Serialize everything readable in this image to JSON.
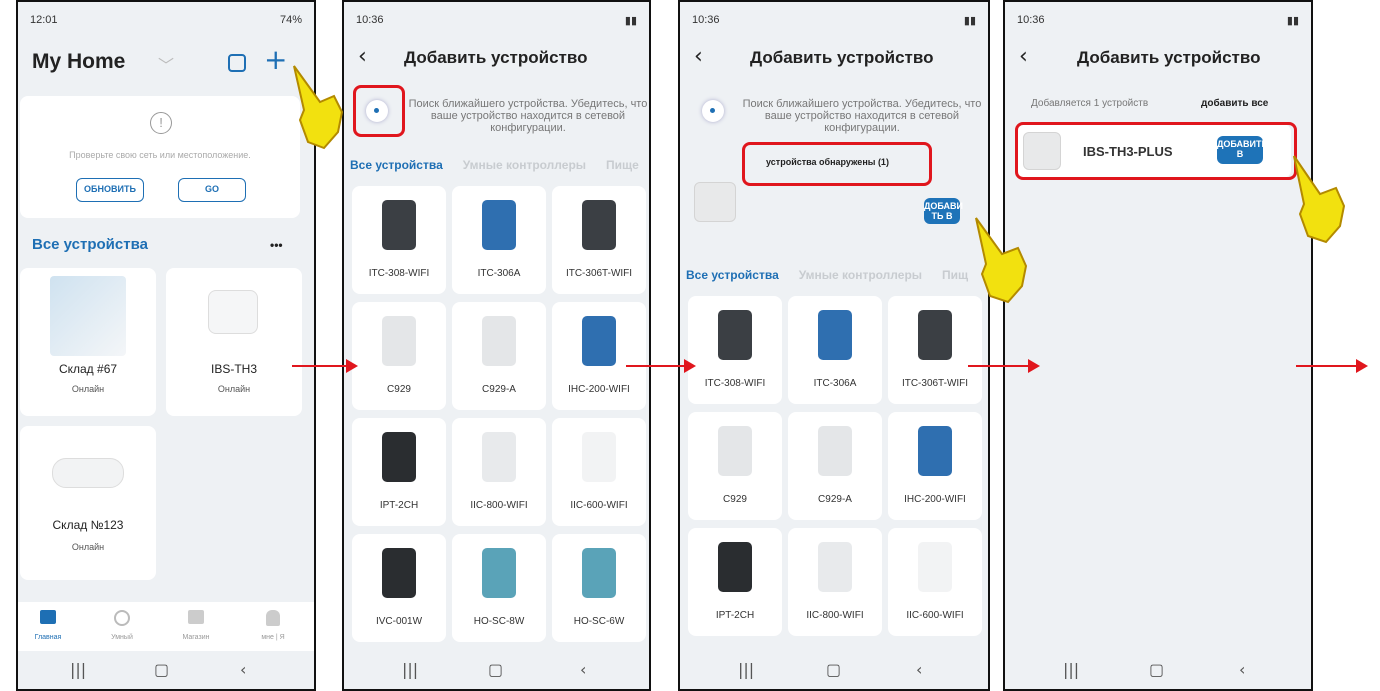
{
  "p1": {
    "status_time": "12:01",
    "status_right": "74%",
    "title": "My Home",
    "alert_text": "Проверьте свою сеть или местоположение.",
    "btn_refresh": "ОБНОВИТЬ",
    "btn_go": "GO",
    "section": "Все устройства",
    "more": "•••",
    "devices": [
      {
        "name": "Склад #67",
        "status": "Онлайн"
      },
      {
        "name": "IBS-TH3",
        "status": "Онлайн"
      },
      {
        "name": "Склад №123",
        "status": "Онлайн"
      }
    ],
    "nav": [
      "Главная",
      "Умный",
      "Магазин",
      "мне | Я"
    ]
  },
  "p2": {
    "status_time": "10:36",
    "title": "Добавить устройство",
    "search_text": "Поиск ближайшего устройства. Убедитесь, что ваше устройство находится в сетевой конфигурации.",
    "tabs": [
      "Все устройства",
      "Умные контроллеры",
      "Пище"
    ],
    "tiles": [
      "ITC-308-WIFI",
      "ITC-306A",
      "ITC-306T-WIFI",
      "C929",
      "C929-A",
      "IHC-200-WIFI",
      "IPT-2CH",
      "IIC-800-WIFI",
      "IIC-600-WIFI",
      "IVC-001W",
      "HO-SC-8W",
      "HO-SC-6W"
    ]
  },
  "p3": {
    "status_time": "10:36",
    "title": "Добавить устройство",
    "search_text": "Поиск ближайшего устройства. Убедитесь, что ваше устройство находится в сетевой конфигурации.",
    "found": "устройства обнаружены (1)",
    "add_btn": "ДОБАВИ ТЬ В",
    "tabs": [
      "Все устройства",
      "Умные контроллеры",
      "Пищ"
    ],
    "tiles": [
      "ITC-308-WIFI",
      "ITC-306A",
      "ITC-306T-WIFI",
      "C929",
      "C929-A",
      "IHC-200-WIFI",
      "IPT-2CH",
      "IIC-800-WIFI",
      "IIC-600-WIFI"
    ]
  },
  "p4": {
    "status_time": "10:36",
    "title": "Добавить устройство",
    "adding": "Добавляется 1 устройств",
    "add_all": "добавить все",
    "device": "IBS-TH3-PLUS",
    "add_btn": "ДОБАВИТЬ В"
  },
  "colors": {
    "accent": "#1e6fb4",
    "highlight": "#e0161d",
    "hand": "#f2e10f"
  }
}
